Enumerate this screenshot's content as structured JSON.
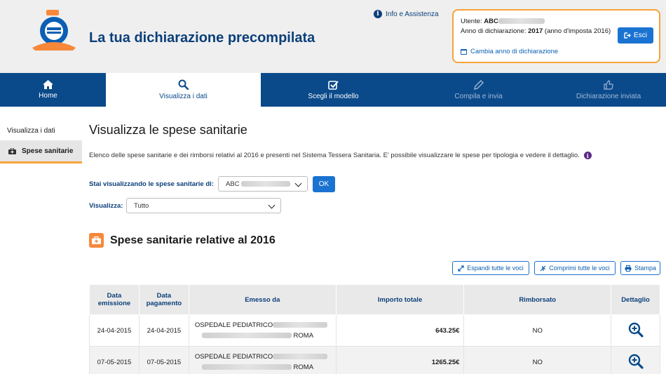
{
  "header": {
    "title": "La tua dichiarazione precompilata",
    "info_link": "Info e Assistenza",
    "user_label": "Utente:",
    "user_value": "ABC",
    "anno_label": "Anno di dichiarazione:",
    "anno_value": "2017",
    "anno_suffix": "(anno d'imposta 2016)",
    "esci_label": "Esci",
    "cambia_label": "Cambia anno di dichiarazione"
  },
  "nav": {
    "items": [
      {
        "label": "Home",
        "icon": "home-icon",
        "state": "normal"
      },
      {
        "label": "Visualizza i dati",
        "icon": "search-icon",
        "state": "active"
      },
      {
        "label": "Scegli il modello",
        "icon": "checkbox-icon",
        "state": "normal"
      },
      {
        "label": "Compila e invia",
        "icon": "pencil-icon",
        "state": "disabled"
      },
      {
        "label": "Dichiarazione inviata",
        "icon": "thumbs-up-icon",
        "state": "disabled"
      }
    ]
  },
  "sidebar": {
    "title": "Visualizza i dati",
    "item": "Spese sanitarie"
  },
  "main": {
    "title": "Visualizza le spese sanitarie",
    "description": "Elenco delle spese sanitarie e dei rimborsi relativi al 2016 e presenti nel Sistema Tessera Sanitaria. E' possibile visualizzare le spese per tipologia e vedere il dettaglio.",
    "select_person_label": "Stai visualizzando le spese sanitarie di:",
    "select_person_value": "ABC",
    "ok_label": "OK",
    "view_label": "Visualizza:",
    "view_value": "Tutto",
    "section_title": "Spese sanitarie relative al 2016",
    "expand_label": "Espandi tutte le voci",
    "collapse_label": "Comprimi tutte le voci",
    "print_label": "Stampa"
  },
  "table": {
    "headers": {
      "data_emissione_1": "Data",
      "data_emissione_2": "emissione",
      "data_pagamento_1": "Data",
      "data_pagamento_2": "pagamento",
      "emesso_da": "Emesso da",
      "importo": "Importo totale",
      "rimborsato": "Rimborsato",
      "dettaglio": "Dettaglio"
    },
    "rows": [
      {
        "data_emissione": "24-04-2015",
        "data_pagamento": "24-04-2015",
        "emesso_line1": "OSPEDALE PEDIATRICO",
        "emesso_line2": "ROMA",
        "importo": "643.25€",
        "rimborsato": "NO"
      },
      {
        "data_emissione": "07-05-2015",
        "data_pagamento": "07-05-2015",
        "emesso_line1": "OSPEDALE PEDIATRICO",
        "emesso_line2": "ROMA",
        "importo": "1265.25€",
        "rimborsato": "NO"
      }
    ]
  },
  "colors": {
    "brand_blue": "#0b4a8a",
    "accent_orange": "#f7a33a",
    "button_blue": "#1b73d1"
  }
}
